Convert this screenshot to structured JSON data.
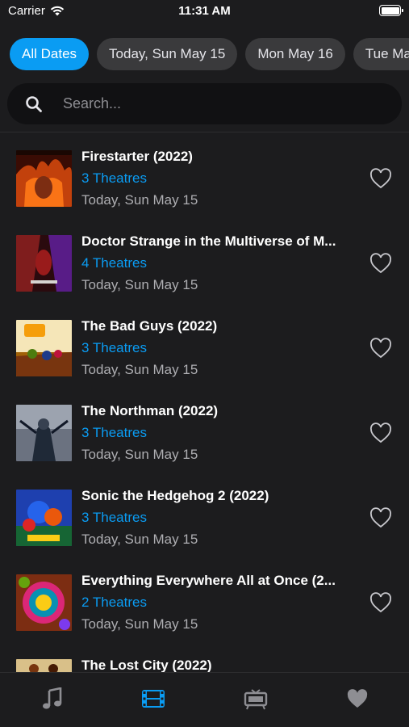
{
  "status_bar": {
    "carrier": "Carrier",
    "time": "11:31 AM"
  },
  "date_filters": [
    "All Dates",
    "Today, Sun May 15",
    "Mon May 16",
    "Tue Ma"
  ],
  "search": {
    "placeholder": "Search..."
  },
  "movies": [
    {
      "title": "Firestarter (2022)",
      "theatres": "3 Theatres",
      "date": "Today, Sun May 15"
    },
    {
      "title": "Doctor Strange in the Multiverse of M...",
      "theatres": "4 Theatres",
      "date": "Today, Sun May 15"
    },
    {
      "title": "The Bad Guys (2022)",
      "theatres": "3 Theatres",
      "date": "Today, Sun May 15"
    },
    {
      "title": "The Northman (2022)",
      "theatres": "3 Theatres",
      "date": "Today, Sun May 15"
    },
    {
      "title": "Sonic the Hedgehog 2 (2022)",
      "theatres": "3 Theatres",
      "date": "Today, Sun May 15"
    },
    {
      "title": "Everything Everywhere All at Once (2...",
      "theatres": "2 Theatres",
      "date": "Today, Sun May 15"
    },
    {
      "title": "The Lost City (2022)",
      "theatres": "",
      "date": ""
    }
  ],
  "tab_bar": {
    "tabs": [
      {
        "icon": "music-note-icon",
        "active": false
      },
      {
        "icon": "film-strip-icon",
        "active": true
      },
      {
        "icon": "theater-icon",
        "active": false
      },
      {
        "icon": "heart-icon",
        "active": false
      }
    ]
  },
  "colors": {
    "accent": "#0a9cf3",
    "background": "#1c1c1e",
    "chip": "#3a3a3c",
    "inactive_icon": "#8e8e93"
  }
}
